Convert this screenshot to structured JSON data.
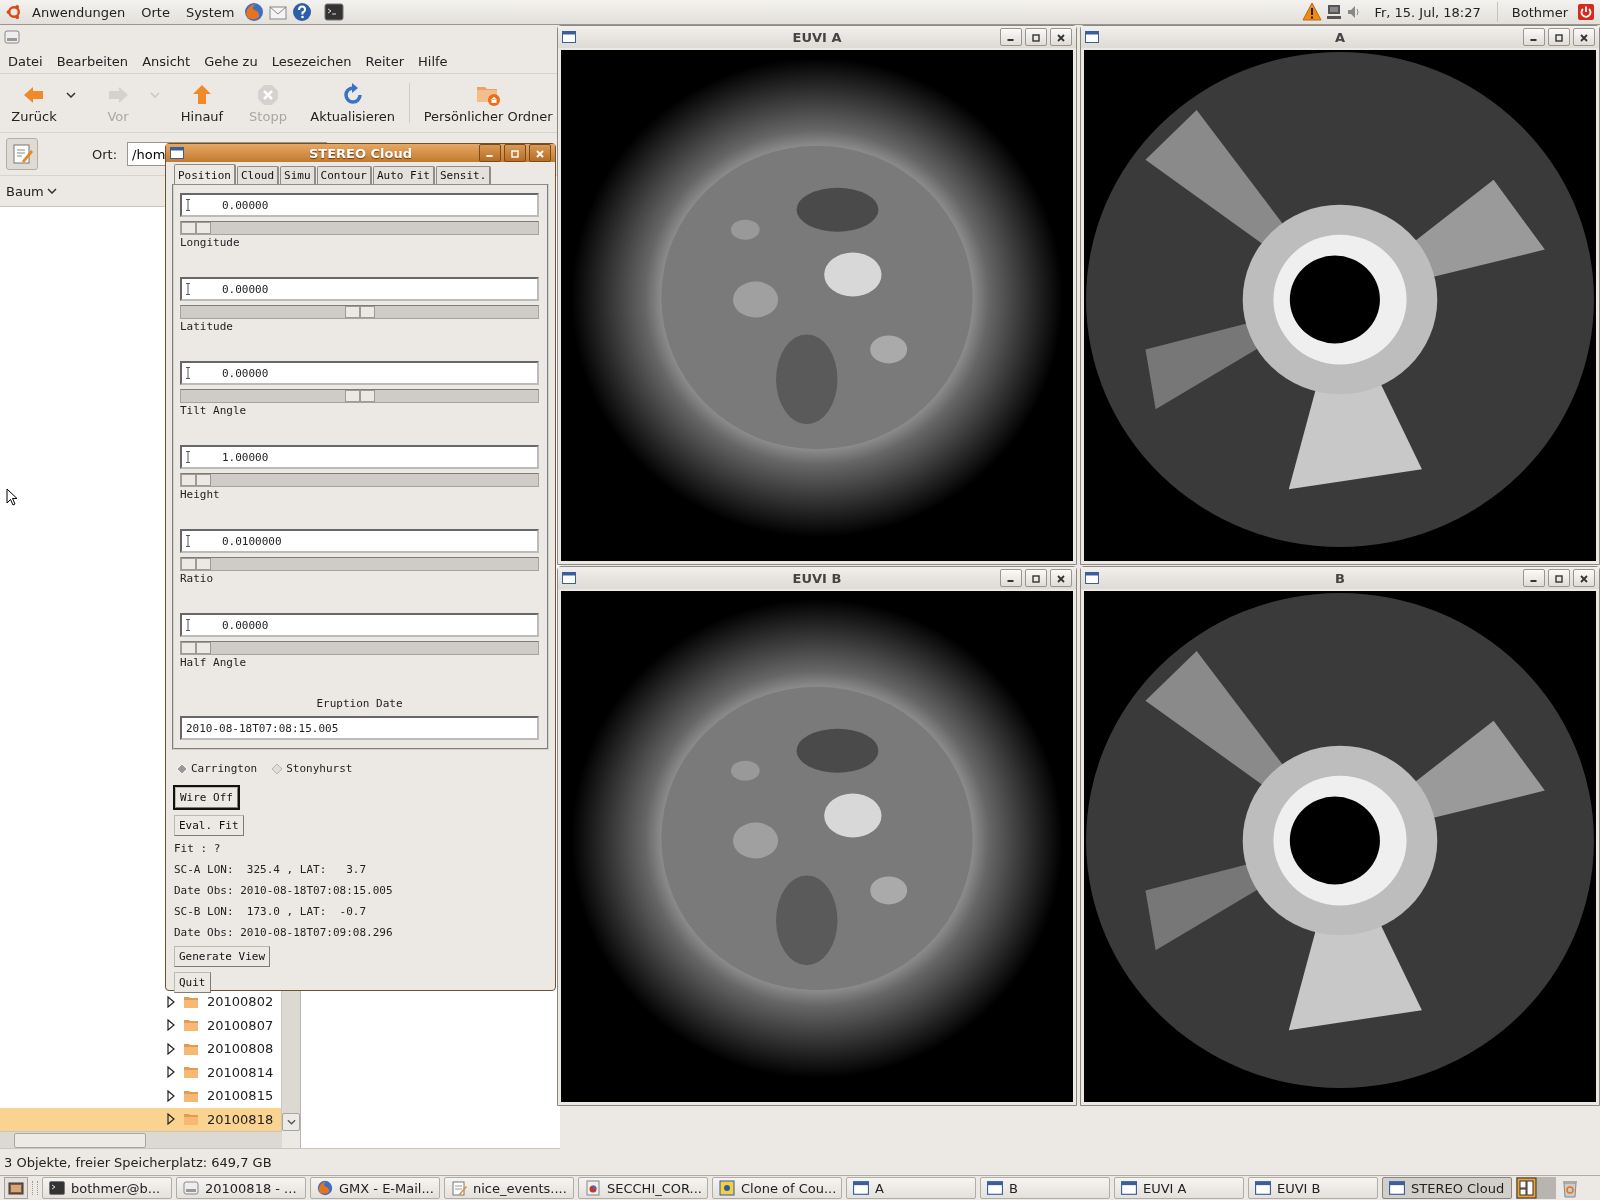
{
  "top_panel": {
    "menus": [
      "Anwendungen",
      "Orte",
      "System"
    ],
    "clock": "Fr, 15. Jul, 18:27",
    "user": "Bothmer"
  },
  "file_manager": {
    "menu": [
      "Datei",
      "Bearbeiten",
      "Ansicht",
      "Gehe zu",
      "Lesezeichen",
      "Reiter",
      "Hilfe"
    ],
    "toolbar": [
      {
        "label": "Zurück",
        "kind": "back",
        "disabled": false,
        "dropdown": true
      },
      {
        "label": "Vor",
        "kind": "forward",
        "disabled": true,
        "dropdown": true
      },
      {
        "label": "Hinauf",
        "kind": "up",
        "disabled": false,
        "dropdown": false
      },
      {
        "label": "Stopp",
        "kind": "stop",
        "disabled": true,
        "dropdown": false
      },
      {
        "label": "Aktualisieren",
        "kind": "reload",
        "disabled": false,
        "dropdown": false
      },
      {
        "label": "Persönlicher Ordner",
        "kind": "home",
        "disabled": false,
        "dropdown": false
      }
    ],
    "location_label": "Ort:",
    "location_value": "/hom",
    "sidebar_mode": "Baum",
    "tree": [
      {
        "label": "20100802",
        "selected": false
      },
      {
        "label": "20100807",
        "selected": false
      },
      {
        "label": "20100808",
        "selected": false
      },
      {
        "label": "20100814",
        "selected": false
      },
      {
        "label": "20100815",
        "selected": false
      },
      {
        "label": "20100818",
        "selected": true
      }
    ],
    "status": "3 Objekte, freier Speicherplatz: 649,7 GB"
  },
  "dialog": {
    "title": "STEREO Cloud",
    "tabs": [
      {
        "label": "Position",
        "selected": true
      },
      {
        "label": "Cloud",
        "selected": false
      },
      {
        "label": "Simu",
        "selected": false
      },
      {
        "label": "Contour",
        "selected": false
      },
      {
        "label": "Auto Fit",
        "selected": false
      },
      {
        "label": "Sensit.",
        "selected": false
      }
    ],
    "fields": [
      {
        "value": "0.00000",
        "label": "Longitude",
        "level": 0
      },
      {
        "value": "0.00000",
        "label": "Latitude",
        "level": 0.5
      },
      {
        "value": "0.00000",
        "label": "Tilt Angle",
        "level": 0.5
      },
      {
        "value": "1.00000",
        "label": "Height",
        "level": 0
      },
      {
        "value": "0.0100000",
        "label": "Ratio",
        "level": 0
      },
      {
        "value": "0.00000",
        "label": "Half Angle",
        "level": 0
      }
    ],
    "eruption_label": "Eruption Date",
    "eruption_value": "2010-08-18T07:08:15.005",
    "coordinates": [
      {
        "label": "Carrington",
        "selected": true
      },
      {
        "label": "Stonyhurst",
        "selected": false
      }
    ],
    "controls": [
      {
        "kind": "button",
        "label": "Wire Off",
        "focused": true
      },
      {
        "kind": "button",
        "label": "Eval. Fit",
        "focused": false
      },
      {
        "kind": "text",
        "label": "Fit : ?"
      },
      {
        "kind": "text",
        "label": "SC-A LON:  325.4 , LAT:   3.7"
      },
      {
        "kind": "text",
        "label": "Date Obs: 2010-08-18T07:08:15.005"
      },
      {
        "kind": "text",
        "label": "SC-B LON:  173.0 , LAT:  -0.7"
      },
      {
        "kind": "text",
        "label": "Date Obs: 2010-08-18T07:09:08.296"
      },
      {
        "kind": "button",
        "label": "Generate View",
        "focused": false
      },
      {
        "kind": "button",
        "label": "Quit",
        "focused": false
      }
    ]
  },
  "image_windows": [
    {
      "title": "EUVI A",
      "kind": "euv"
    },
    {
      "title": "A",
      "kind": "coronagraph"
    },
    {
      "title": "EUVI B",
      "kind": "euv"
    },
    {
      "title": "B",
      "kind": "coronagraph"
    }
  ],
  "taskbar": [
    {
      "label": "bothmer@b...",
      "kind": "terminal",
      "selected": false
    },
    {
      "label": "20100818 - ...",
      "kind": "folder",
      "selected": false
    },
    {
      "label": "GMX - E-Mail...",
      "kind": "browser",
      "selected": false
    },
    {
      "label": "nice_events....",
      "kind": "editor",
      "selected": false
    },
    {
      "label": "SECCHI_COR...",
      "kind": "document",
      "selected": false
    },
    {
      "label": "Clone of Cou...",
      "kind": "app",
      "selected": false
    },
    {
      "label": "A",
      "kind": "window",
      "selected": false
    },
    {
      "label": "B",
      "kind": "window",
      "selected": false
    },
    {
      "label": "EUVI A",
      "kind": "window",
      "selected": false
    },
    {
      "label": "EUVI B",
      "kind": "window",
      "selected": false
    },
    {
      "label": "STEREO Cloud",
      "kind": "window",
      "selected": true
    }
  ]
}
